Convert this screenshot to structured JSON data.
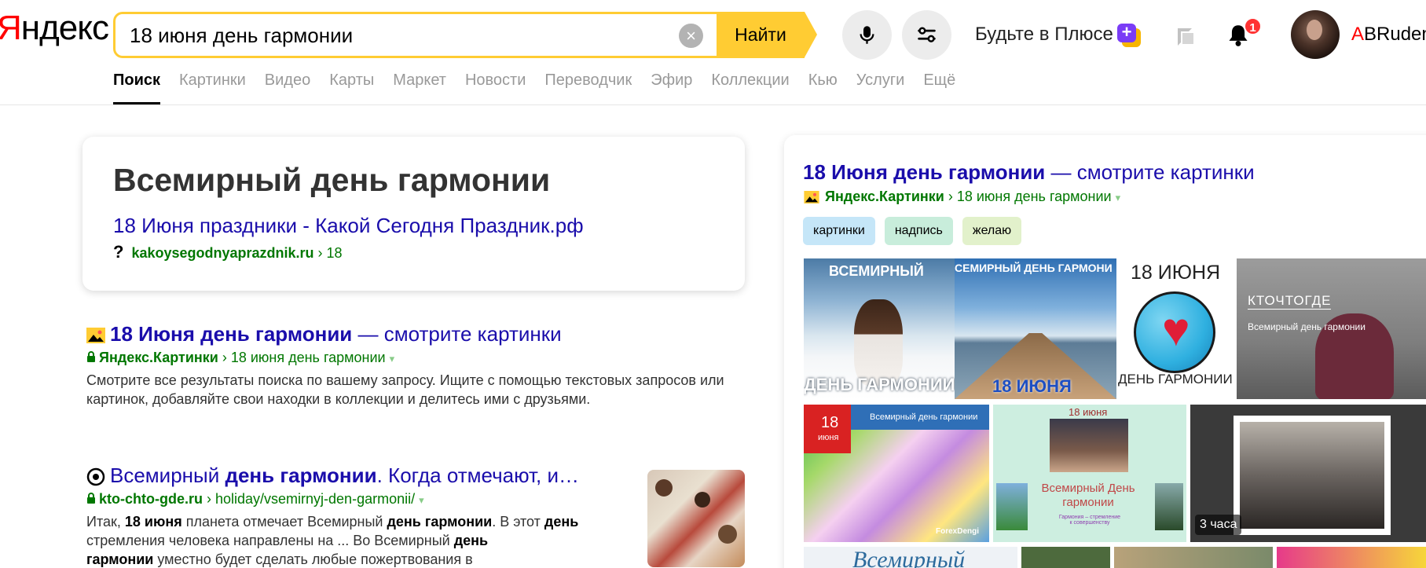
{
  "header": {
    "logo_first": "Я",
    "logo_rest": "ндекс",
    "search": {
      "value": "18 июня день гармонии",
      "clear_icon": "×",
      "button_label": "Найти"
    },
    "plus_text": "Будьте в Плюсе",
    "plus_badge_glyph": "+",
    "notifications_count": "1",
    "user": {
      "first_letter": "A",
      "rest": "BRuden"
    }
  },
  "tabs": [
    {
      "label": "Поиск",
      "active": true
    },
    {
      "label": "Картинки"
    },
    {
      "label": "Видео"
    },
    {
      "label": "Карты"
    },
    {
      "label": "Маркет"
    },
    {
      "label": "Новости"
    },
    {
      "label": "Переводчик"
    },
    {
      "label": "Эфир"
    },
    {
      "label": "Коллекции"
    },
    {
      "label": "Кью"
    },
    {
      "label": "Услуги"
    },
    {
      "label": "Ещё"
    }
  ],
  "answer": {
    "title": "Всемирный день гармонии",
    "link": "18 Июня праздники - Какой Сегодня Праздник.рф",
    "src_icon": "?",
    "domain": "kakoysegodnyaprazdnik.ru",
    "path": "› 18"
  },
  "results": [
    {
      "title_bold": "18 Июня день гармонии",
      "title_rest": " — смотрите картинки",
      "domain": "Яндекс.Картинки",
      "path": " › 18 июня день гармонии ",
      "tri": "▾",
      "snippet": "Смотрите все результаты поиска по вашему запросу. Ищите с помощью текстовых запросов или картинок, добавляйте свои находки в коллекции и делитесь ими с друзьями."
    },
    {
      "title_a": "Всемирный ",
      "title_b": "день гармонии",
      "title_c": ". Когда отмечают, и…",
      "domain": "kto-chto-gde.ru",
      "path": " › holiday/vsemirnyj-den-garmonii/ ",
      "tri": "▾",
      "snip_1": "Итак, ",
      "snip_2": "18 июня",
      "snip_3": " планета отмечает Всемирный ",
      "snip_4": "день гармонии",
      "snip_5": ". В этот ",
      "snip_6": "день",
      "snip_7": " стремления человека направлены на ... Во Всемирный ",
      "snip_8": "день",
      "snip_9": "гармонии",
      "snip_10": " уместно будет сделать любые пожертвования в"
    }
  ],
  "images_card": {
    "title_bold": "18 Июня день гармонии",
    "title_rest": " — смотрите картинки",
    "domain": "Яндекс.Картинки",
    "path": " › 18 июня день гармонии ",
    "tri": "▾",
    "chips": [
      "картинки",
      "надпись",
      "желаю"
    ],
    "img1_top": "ВСЕМИРНЫЙ",
    "img1_bottom": "ДЕНЬ ГАРМОНИИ",
    "img2_top": "СЕМИРНЫЙ ДЕНЬ ГАРМОНИ",
    "img2_bottom": "18 ИЮНЯ",
    "img3_top": "18 ИЮНЯ",
    "img3_bottom": "ДЕНЬ ГАРМОНИИ",
    "img4_logo": "КТОЧТОГДЕ",
    "img4_sub": "Всемирный день гармонии",
    "img5_day": "18",
    "img5_month": "июня",
    "img5_bar": "Всемирный день гармонии",
    "img5_brand": "ForexDengi",
    "img6_top": "18 июня",
    "img6_title": "Всемирный День гармонии",
    "img6_sub": "Гармония – стремление к совершенству",
    "img7_time": "3 часа",
    "img8_text": "Всемирный"
  }
}
